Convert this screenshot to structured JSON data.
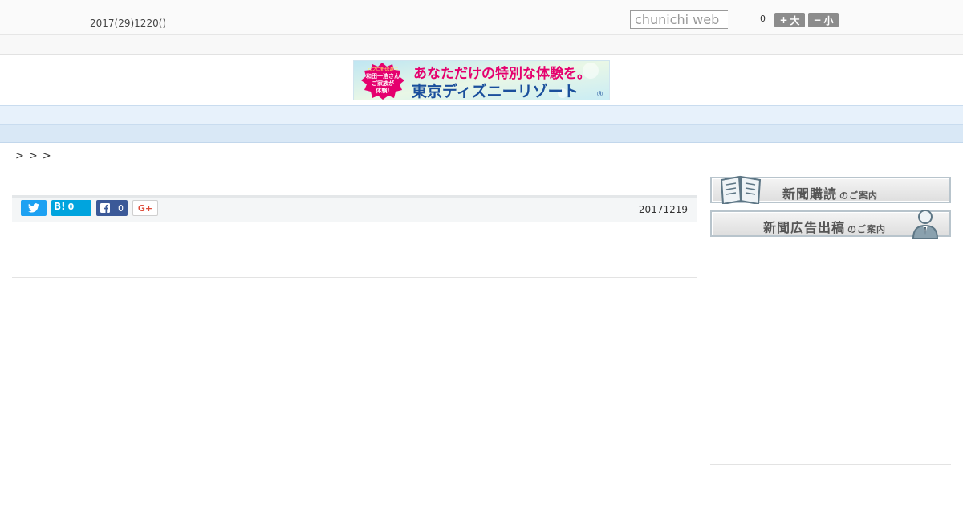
{
  "header": {
    "date": "2017(29)1220()",
    "search_placeholder": "chunichi web",
    "counter": "0",
    "font_larger_label": "大",
    "font_smaller_label": "小"
  },
  "banner": {
    "headline": "あなただけの特別な体験を。",
    "brand": "東京ディズニーリゾート",
    "registered_mark": "®",
    "badge_lines": [
      "元プロ野球選手",
      "和田一浩さん",
      "ご家族が",
      "体験!"
    ]
  },
  "nav": {
    "items": [
      {
        "label": "　　"
      },
      {
        "label": "　　"
      },
      {
        "label": "　　"
      },
      {
        "label": "　　"
      },
      {
        "label": "　　"
      },
      {
        "label": "　　"
      },
      {
        "label": "　　"
      },
      {
        "label": "　　"
      },
      {
        "label": "　　"
      }
    ]
  },
  "breadcrumb": ">>>",
  "article": {
    "date": "20171219",
    "share": {
      "hatena_mark": "B!",
      "hatena_count": "0",
      "facebook_count": "0",
      "gplus_label": "G+"
    }
  },
  "sidebar": {
    "subscribe": {
      "main": "新聞購読",
      "small": "のご案内"
    },
    "advertise": {
      "main": "新聞広告出稿",
      "small": "のご案内"
    }
  },
  "colors": {
    "nav_bg": "#e7f1fb",
    "twitter": "#1da1f2",
    "hatena": "#00a4de",
    "facebook": "#3b5998",
    "banner_headline": "#e5006e",
    "banner_brand": "#1a4f9c"
  }
}
